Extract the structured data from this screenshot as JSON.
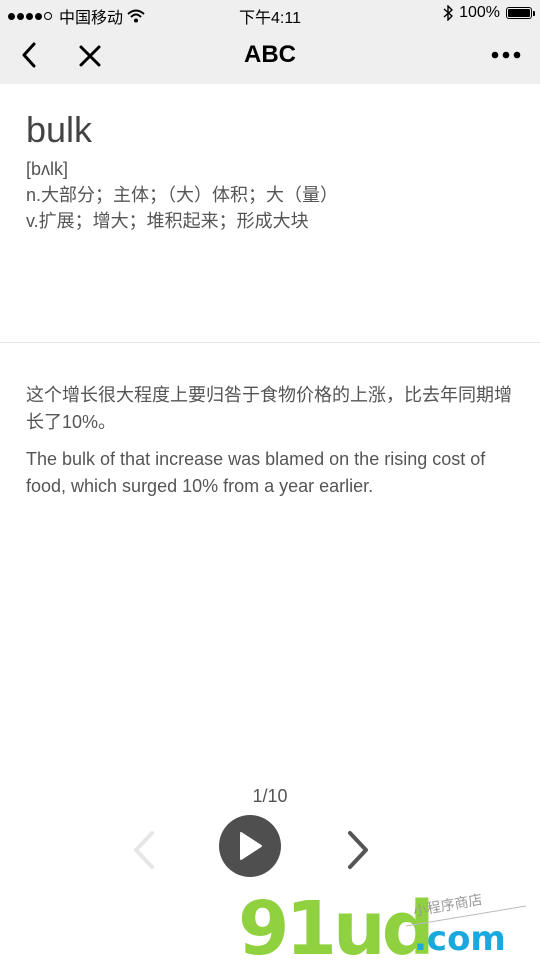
{
  "status_bar": {
    "carrier": "中国移动",
    "time": "下午4:11",
    "battery": "100%",
    "battery_level": 1.0
  },
  "nav": {
    "title": "ABC"
  },
  "word": {
    "headword": "bulk",
    "phonetic": "[bʌlk]",
    "definitions": [
      "n.大部分；主体；（大）体积；大（量）",
      "v.扩展；增大；堆积起来；形成大块"
    ]
  },
  "example": {
    "chinese": "这个增长很大程度上要归咎于食物价格的上涨，比去年同期增长了10%。",
    "english": "The bulk of that increase was blamed on the rising cost of food, which surged 10% from a year earlier."
  },
  "pager": {
    "position": "1/10"
  },
  "watermark": {
    "logo": "91ud",
    "domain": ".com",
    "tagline": "小程序商店"
  },
  "colors": {
    "bar_background": "#efefef",
    "play_button": "#4f4f4f",
    "watermark_green": "#8fd13f",
    "watermark_blue": "#1aa9de"
  }
}
